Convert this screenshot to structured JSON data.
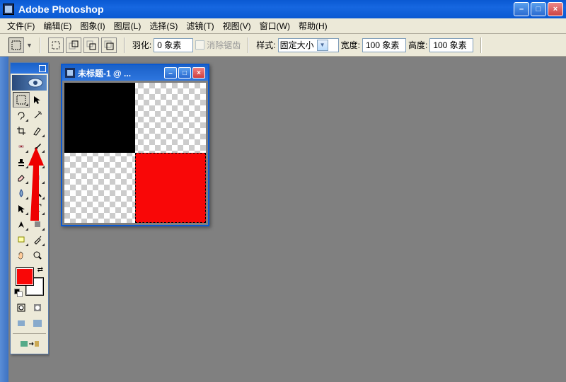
{
  "title": "Adobe Photoshop",
  "menu": [
    "文件(F)",
    "编辑(E)",
    "图象(I)",
    "图层(L)",
    "选择(S)",
    "滤镜(T)",
    "视图(V)",
    "窗口(W)",
    "帮助(H)"
  ],
  "options": {
    "feather_label": "羽化:",
    "feather_value": "0 象素",
    "antialias": "消除锯齿",
    "style_label": "样式:",
    "style_value": "固定大小",
    "width_label": "宽度:",
    "width_value": "100 象素",
    "height_label": "高度:",
    "height_value": "100 象素"
  },
  "doc": {
    "title": "未标题-1 @ ..."
  },
  "colors": {
    "fg": "#f90707",
    "bg": "#ffffff"
  },
  "tools_left": [
    "marquee",
    "move",
    "lasso",
    "wand",
    "crop",
    "slice",
    "heal",
    "brush",
    "stamp",
    "history",
    "eraser",
    "gradient",
    "blur",
    "dodge",
    "path",
    "type",
    "pen",
    "shape",
    "notes",
    "eyedrop",
    "hand",
    "zoom"
  ]
}
